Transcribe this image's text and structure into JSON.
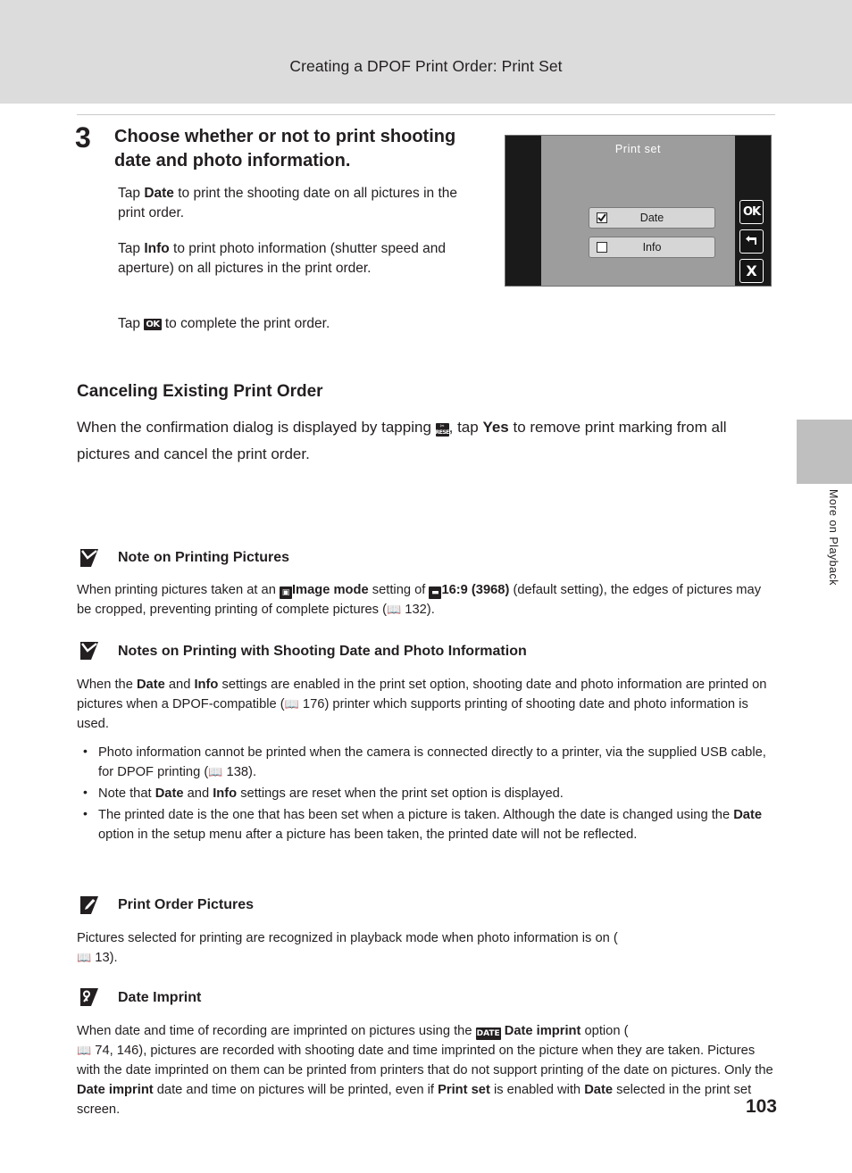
{
  "header": {
    "title": "Creating a DPOF Print Order: Print Set"
  },
  "step": {
    "number": "3",
    "heading": "Choose whether or not to print shooting date and photo information.",
    "p1_pre": "Tap ",
    "p1_bold": "Date",
    "p1_post": " to print the shooting date on all pictures in the print order.",
    "p2_pre": "Tap ",
    "p2_bold": "Info",
    "p2_post": " to print photo information (shutter speed and aperture) on all pictures in the print order.",
    "p3_pre": "Tap ",
    "p3_icon": "OK",
    "p3_post": " to complete the print order."
  },
  "screen": {
    "title": "Print set",
    "date_label": "Date",
    "info_label": "Info",
    "date_checked": true,
    "info_checked": false,
    "btn_ok": "OK",
    "btn_back": "back-arrow-icon",
    "btn_cancel": "X"
  },
  "canceling": {
    "title": "Canceling Existing Print Order",
    "pre": "When the confirmation dialog is displayed by tapping ",
    "icon": "RESET",
    "mid": ", tap ",
    "bold": "Yes",
    "post": " to remove print marking from all pictures and cancel the print order."
  },
  "side_tab": {
    "label": "More on Playback"
  },
  "notes": [
    {
      "id": "note-printing-pictures",
      "icon": "caution-icon",
      "title": "Note on Printing Pictures",
      "body_1": "When printing pictures taken at an ",
      "body_icon_1": "image-mode-icon",
      "body_bold_1": "Image mode",
      "body_2": " setting of ",
      "body_icon_2": "ratio-icon",
      "body_bold_2": "16:9 (3968)",
      "body_3": " (default setting), the edges of pictures may be cropped, preventing printing of complete pictures (",
      "ref": "132",
      "body_4": ")."
    },
    {
      "id": "note-printing-date-info",
      "icon": "caution-icon",
      "title": "Notes on Printing with Shooting Date and Photo Information",
      "body_1": "When the ",
      "bold_1": "Date",
      "body_2": " and ",
      "bold_2": "Info",
      "body_3": " settings are enabled in the print set option, shooting date and photo information are printed on pictures when a DPOF-compatible (",
      "ref": "176",
      "body_4": ") printer which supports printing of shooting date and photo information is used.",
      "bullets": [
        {
          "t1": "Photo information cannot be printed when the camera is connected directly to a printer, via the supplied USB cable, for DPOF printing (",
          "ref": "138",
          "t2": ")."
        },
        {
          "t1": "Note that ",
          "b1": "Date",
          "t2": " and ",
          "b2": "Info",
          "t3": " settings are reset when the print set option is displayed."
        },
        {
          "t1": "The printed date is the one that has been set when a picture is taken. Although the date is changed using the ",
          "b1": "Date",
          "t2": " option in the setup menu after a picture has been taken, the printed date will not be reflected."
        }
      ]
    },
    {
      "id": "note-print-order-pictures",
      "icon": "pencil-icon",
      "title": "Print Order Pictures",
      "body_1": "Pictures selected for printing are recognized in playback mode when photo information is on (",
      "ref": "13",
      "body_2": ")."
    },
    {
      "id": "note-date-imprint",
      "icon": "key-icon",
      "title": "Date Imprint",
      "body_1": "When date and time of recording are imprinted on pictures using the ",
      "icon_inline": "date-imprint-icon",
      "bold_1": "Date imprint",
      "body_2": " option (",
      "ref": "74, 146",
      "body_3": "), pictures are recorded with shooting date and time imprinted on the picture when they are taken. Pictures with the date imprinted on them can be printed from printers that do not support printing of the date on pictures. Only the ",
      "bold_2": "Date imprint",
      "body_4": " date and time on pictures will be printed, even if ",
      "bold_3": "Print set",
      "body_5": " is enabled with ",
      "bold_4": "Date",
      "body_6": " selected in the print set screen."
    }
  ],
  "page_number": "103"
}
